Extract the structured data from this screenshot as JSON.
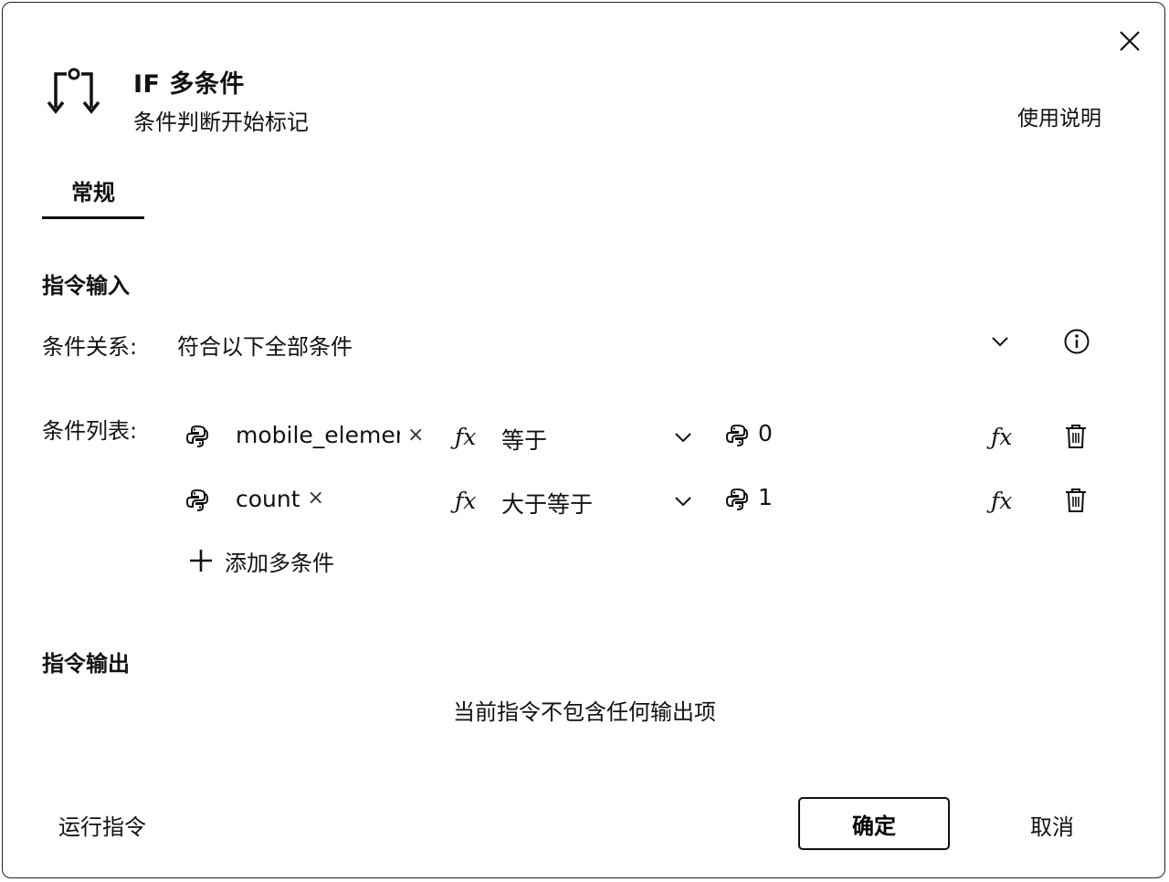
{
  "header": {
    "title": "IF 多条件",
    "subtitle": "条件判断开始标记",
    "help_link": "使用说明",
    "icon": "if-branch-icon"
  },
  "tabs": [
    {
      "label": "常规",
      "active": true
    }
  ],
  "input_section": {
    "title": "指令输入",
    "relation": {
      "label": "条件关系:",
      "value": "符合以下全部条件"
    },
    "conditions": {
      "label": "条件列表:",
      "rows": [
        {
          "left": "mobile_elemer",
          "operator": "等于",
          "right": "0"
        },
        {
          "left": "count",
          "operator": "大于等于",
          "right": "1"
        }
      ],
      "add_label": "添加多条件"
    }
  },
  "output_section": {
    "title": "指令输出",
    "empty_text": "当前指令不包含任何输出项"
  },
  "footer": {
    "run_label": "运行指令",
    "ok_label": "确定",
    "cancel_label": "取消"
  },
  "icons": [
    "close-icon",
    "if-branch-icon",
    "chevron-down-icon",
    "info-icon",
    "python-icon",
    "fx-icon",
    "trash-icon",
    "plus-icon",
    "remove-x-icon"
  ]
}
